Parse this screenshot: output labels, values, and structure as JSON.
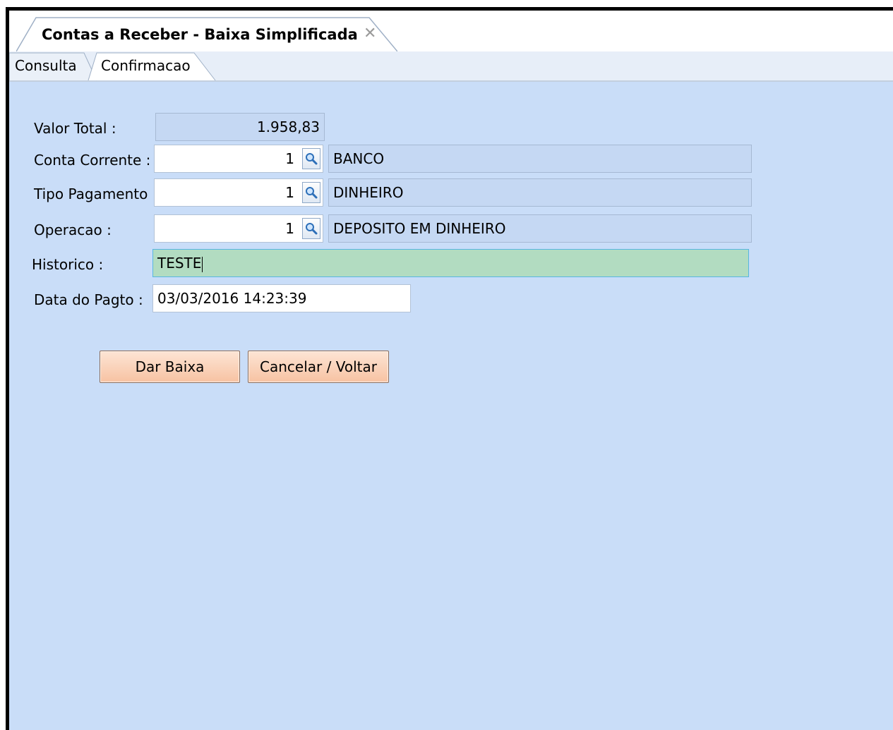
{
  "window": {
    "doc_tab_title": "Contas a Receber - Baixa Simplificada",
    "close_glyph": "✕"
  },
  "tabs": [
    {
      "label": "Consulta",
      "active": false
    },
    {
      "label": "Confirmacao",
      "active": true
    }
  ],
  "form": {
    "valor_total": {
      "label": "Valor Total  :",
      "value": "1.958,83"
    },
    "conta_corrente": {
      "label": "Conta Corrente :",
      "code": "1",
      "description": "BANCO"
    },
    "tipo_pagamento": {
      "label": "Tipo Pagamento :",
      "code": "1",
      "description": "DINHEIRO"
    },
    "operacao": {
      "label": "Operacao :",
      "code": "1",
      "description": "DEPOSITO EM DINHEIRO"
    },
    "historico": {
      "label": "Historico :",
      "value": "TESTE"
    },
    "data_pagto": {
      "label": "Data do Pagto :",
      "value": "03/03/2016 14:23:39"
    }
  },
  "buttons": {
    "dar_baixa": "Dar Baixa",
    "cancelar": "Cancelar / Voltar"
  },
  "icons": {
    "lookup": "magnifier-icon",
    "close": "close-icon"
  },
  "colors": {
    "background": "#c9ddf8",
    "field_readonly": "#c5d8f3",
    "historico_focus": "#b2dcc1",
    "button": "#f7c2a2"
  }
}
